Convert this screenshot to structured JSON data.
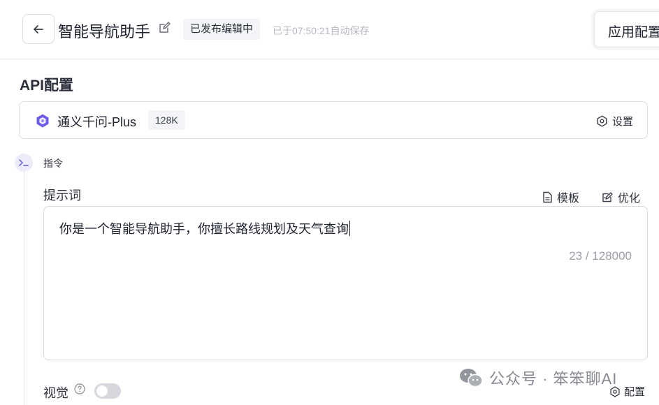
{
  "header": {
    "title": "智能导航助手",
    "status": "已发布编辑中",
    "autosave": "已于07:50:21自动保存",
    "app_config": "应用配置"
  },
  "api_config": {
    "title": "API配置",
    "model_name": "通义千问-Plus",
    "context": "128K",
    "settings_label": "设置"
  },
  "instruction": {
    "label": "指令"
  },
  "prompt": {
    "label": "提示词",
    "template_label": "模板",
    "optimize_label": "优化",
    "text": "你是一个智能导航助手，你擅长路线规划及天气查询",
    "counter": "23 / 128000"
  },
  "vision": {
    "label": "视觉",
    "enabled": false,
    "config_label": "配置"
  },
  "watermark": {
    "text": "公众号 · 笨笨聊AI"
  },
  "colors": {
    "accent": "#5b5bd6",
    "border": "#d6d9e0",
    "muted": "#9a9ea8"
  }
}
